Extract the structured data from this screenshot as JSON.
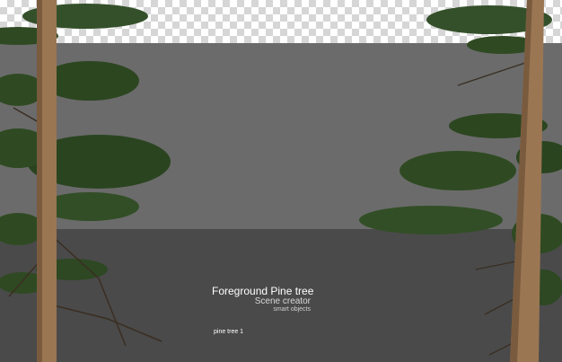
{
  "caption": {
    "title": "Foreground Pine tree",
    "subtitle": "Scene creator",
    "tagline": "smart objects"
  },
  "item_label": "pine tree 1",
  "colors": {
    "checker_light": "#ffffff",
    "checker_dark": "#d6d6d6",
    "mid_band": "#6b6b6b",
    "low_band": "#4a4a4a",
    "trunk": "#9b7653",
    "needles": "#2f4a22"
  }
}
